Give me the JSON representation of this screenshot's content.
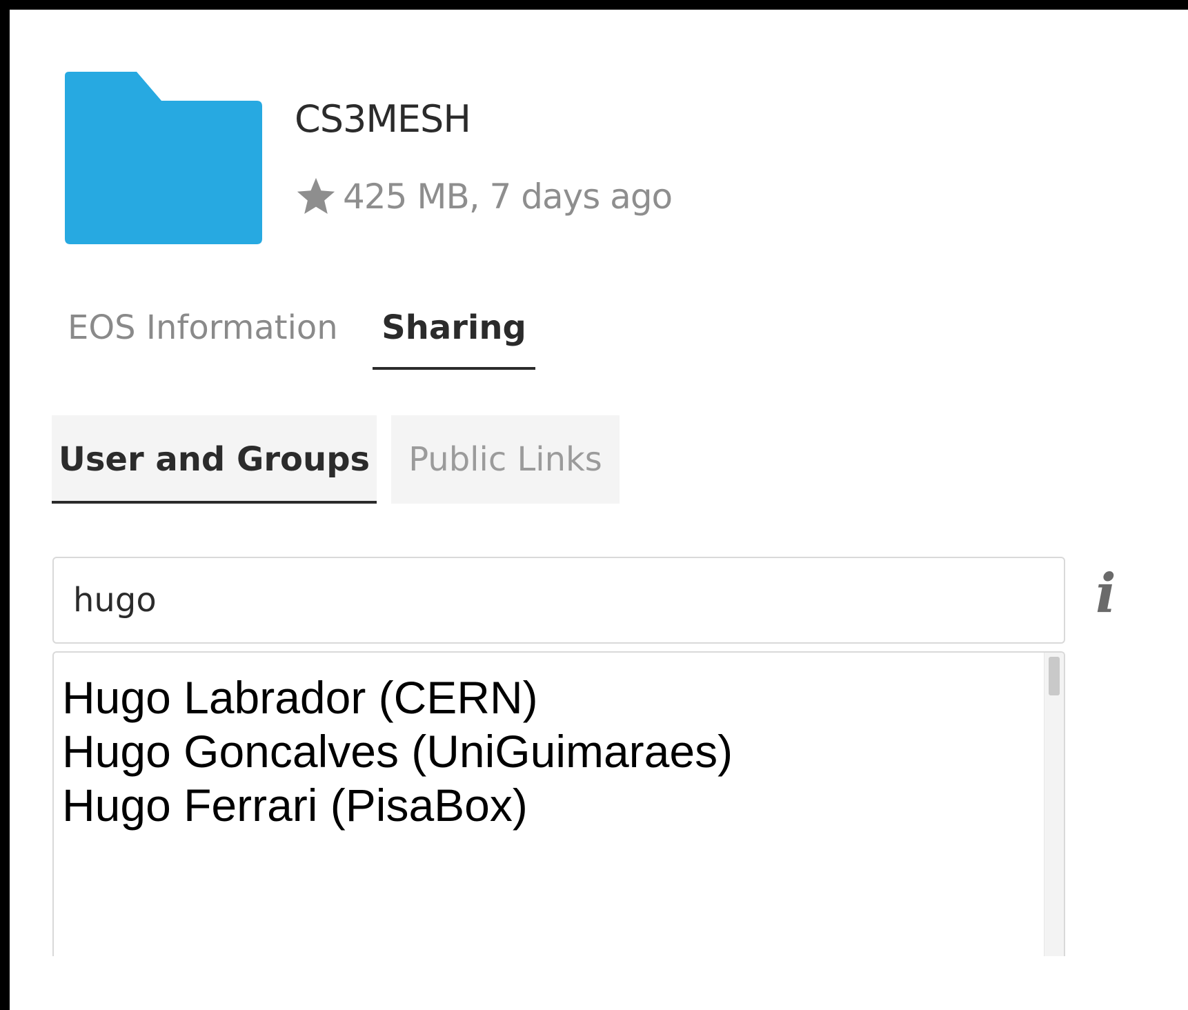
{
  "file": {
    "name": "CS3MESH",
    "meta": "425 MB, 7 days ago",
    "icon": "folder-icon",
    "favorite_icon": "star-icon",
    "folder_color": "#27a9e1"
  },
  "tabs": [
    {
      "label": "EOS Information",
      "active": false
    },
    {
      "label": "Sharing",
      "active": true
    }
  ],
  "sharing": {
    "subtabs": [
      {
        "label": "User and Groups",
        "active": true
      },
      {
        "label": "Public Links",
        "active": false
      }
    ],
    "search": {
      "value": "hugo",
      "placeholder": ""
    },
    "info_icon": "i",
    "suggestions": [
      "Hugo Labrador (CERN)",
      "Hugo Goncalves (UniGuimaraes)",
      "Hugo Ferrari (PisaBox)"
    ]
  }
}
